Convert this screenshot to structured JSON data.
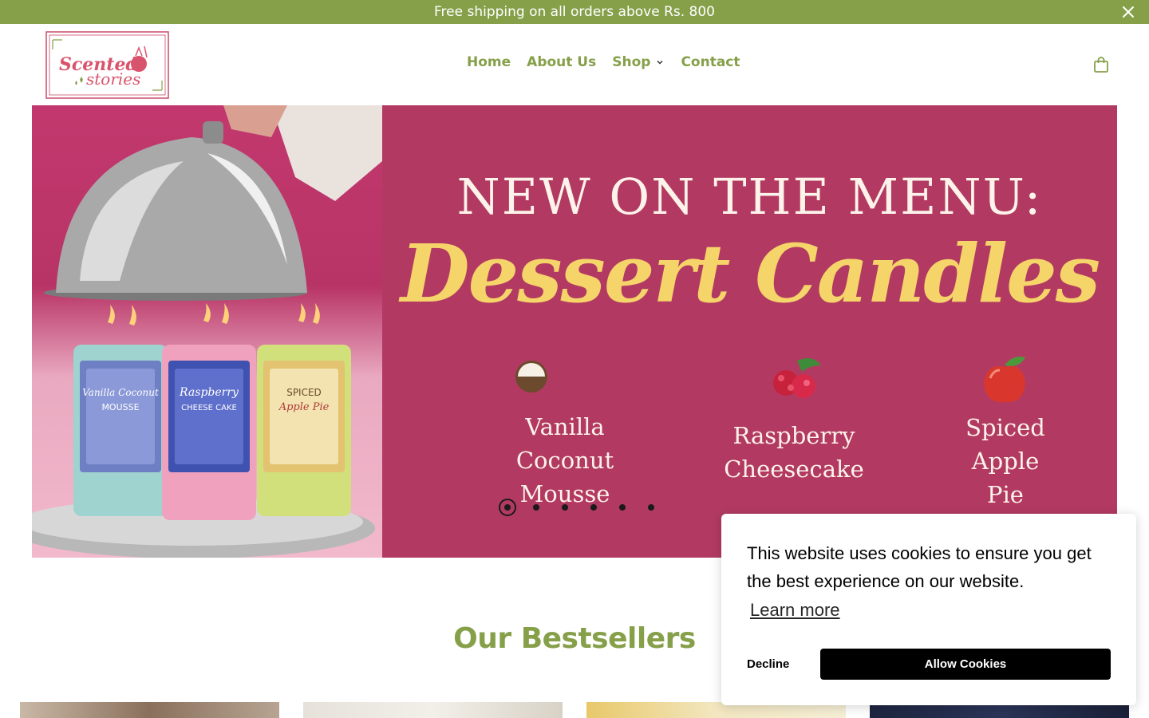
{
  "announcement": {
    "text": "Free shipping on all orders above Rs. 800",
    "close_icon": "close-icon",
    "background": "#86a04a"
  },
  "header": {
    "logo_line1": "Scented",
    "logo_line2": "stories",
    "nav": [
      {
        "label": "Home"
      },
      {
        "label": "About Us"
      },
      {
        "label": "Shop",
        "has_dropdown": true
      },
      {
        "label": "Contact"
      }
    ],
    "cart_icon": "shopping-bag-icon",
    "accent": "#86a04a"
  },
  "hero": {
    "headline": "NEW ON THE MENU:",
    "script_title": "Dessert Candles",
    "flavors": [
      {
        "line1": "Vanilla",
        "line2": "Coconut",
        "line3": "Mousse",
        "icon": "coconut-icon"
      },
      {
        "line1": "Raspberry",
        "line2": "Cheesecake",
        "line3": "",
        "icon": "raspberry-icon"
      },
      {
        "line1": "Spiced",
        "line2": "Apple",
        "line3": "Pie",
        "icon": "apple-icon"
      }
    ],
    "jar_labels": [
      {
        "top": "Vanilla Coconut",
        "bottom": "MOUSSE"
      },
      {
        "top": "Raspberry",
        "bottom": "CHEESE CAKE"
      },
      {
        "top": "SPICED",
        "bottom": "Apple Pie"
      }
    ],
    "slides_total": 6,
    "active_slide": 1,
    "colors": {
      "panel": "#b23a62",
      "script": "#f5d46a",
      "headline": "#fdf3ea"
    }
  },
  "bestsellers": {
    "title": "Our Bestsellers"
  },
  "cookie_banner": {
    "message": "This website uses cookies to ensure you get the best experience on our website.",
    "learn_more": "Learn more",
    "decline": "Decline",
    "allow": "Allow Cookies"
  }
}
